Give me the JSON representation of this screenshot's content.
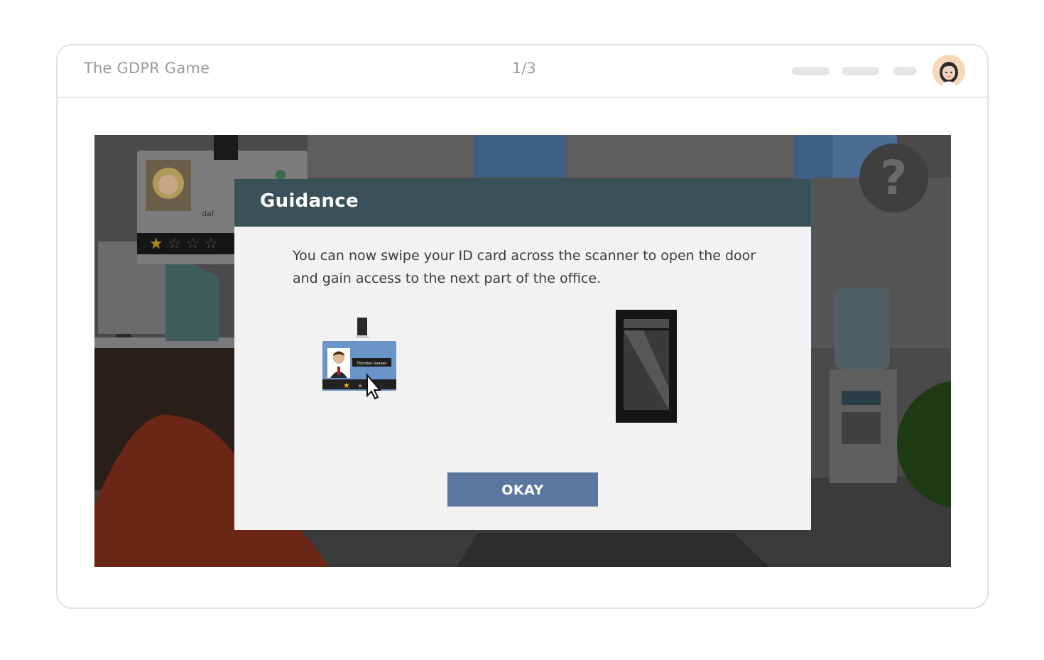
{
  "header": {
    "title": "The GDPR Game",
    "progress": "1/3",
    "avatar_icon": "user-avatar-icon"
  },
  "scene": {
    "profile_name": "daf",
    "profile_rating": 1,
    "profile_rating_max": 4,
    "help_label": "?"
  },
  "dialog": {
    "title": "Guidance",
    "body": "You can now swipe your ID card across the scanner to open the door and gain access to the next part of the office.",
    "card_name": "Thorsten Iversen",
    "button_label": "OKAY"
  },
  "colors": {
    "header_bar": "#3b5159",
    "button": "#5b779f",
    "dialog_bg": "#f2f2f2"
  }
}
